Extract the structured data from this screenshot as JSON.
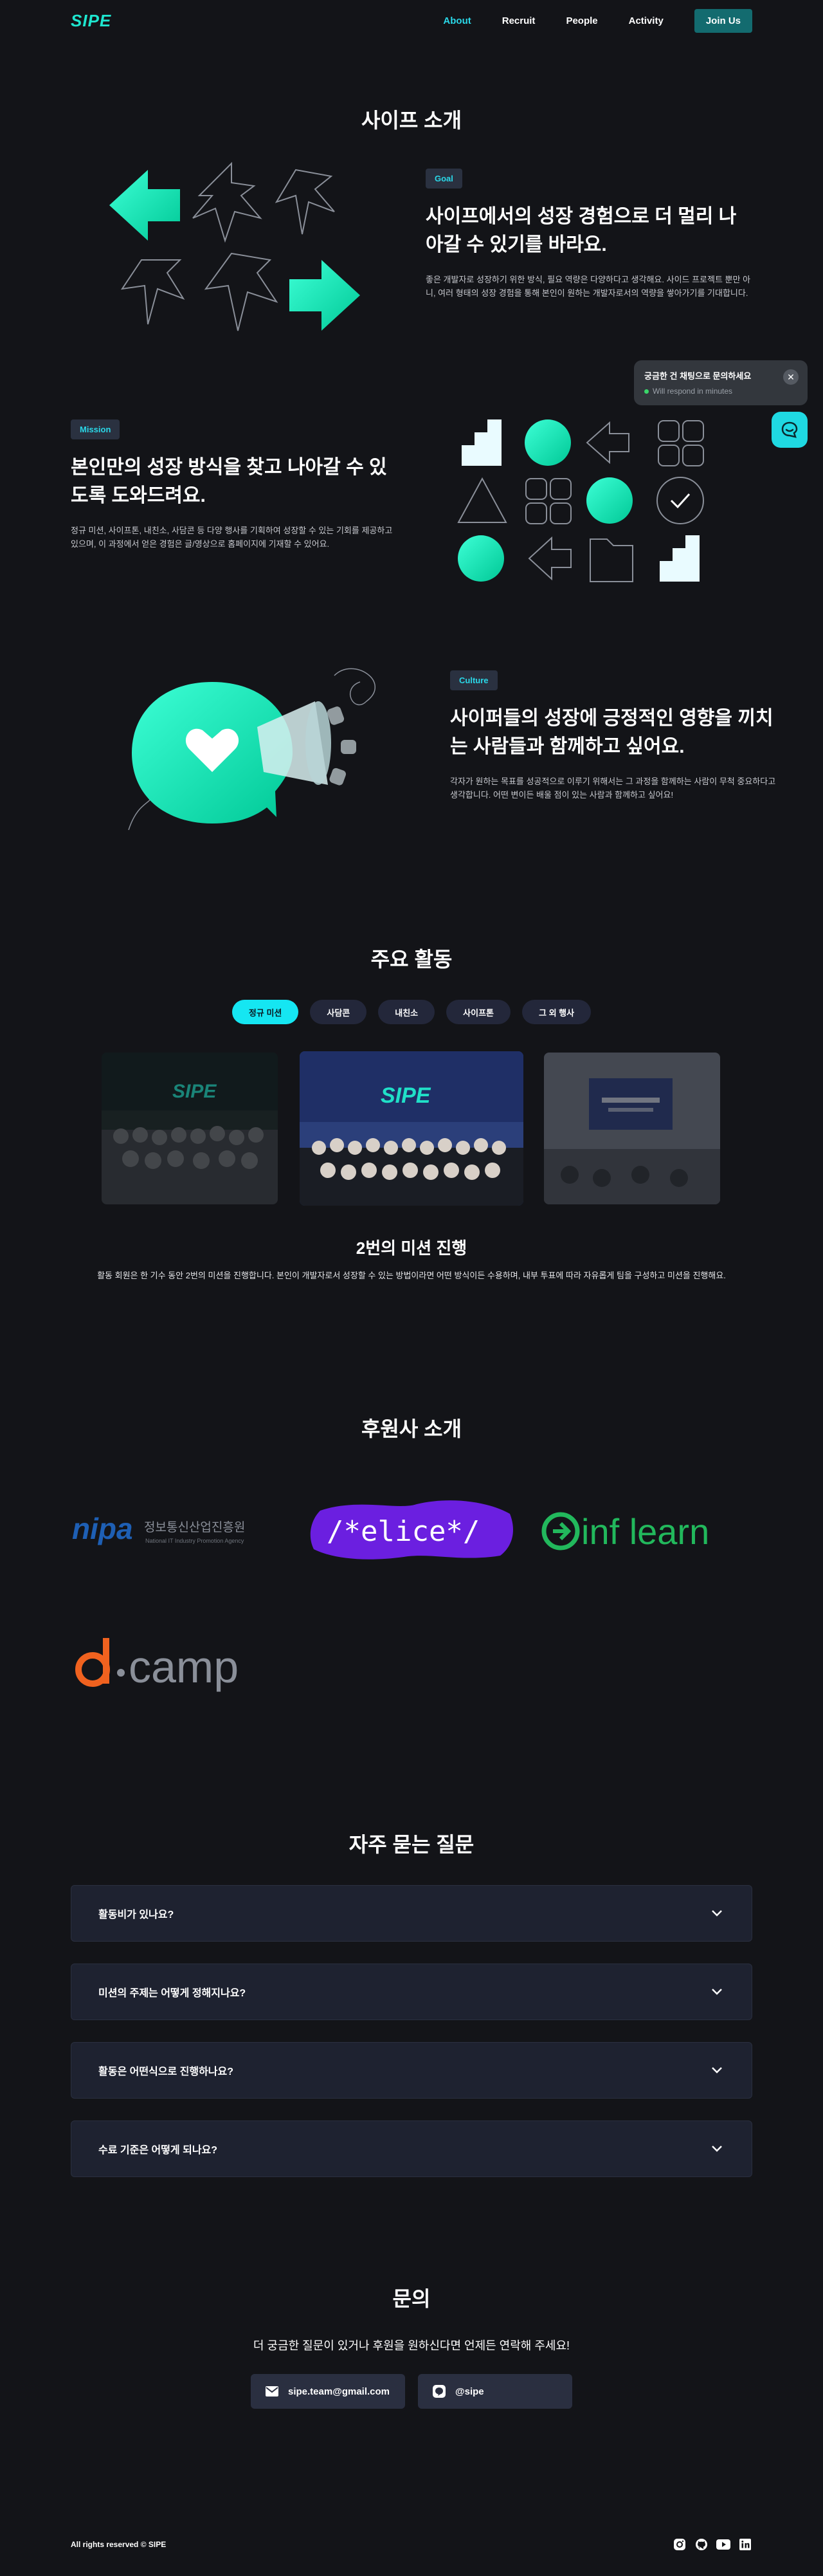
{
  "nav": {
    "logo": "SIPE",
    "links": [
      "About",
      "Recruit",
      "People",
      "Activity"
    ],
    "active": "About",
    "join_label": "Join Us"
  },
  "intro": {
    "title": "사이프 소개",
    "blocks": [
      {
        "tag": "Goal",
        "heading": "사이프에서의 성장 경험으로 더 멀리 나아갈 수 있기를 바라요.",
        "desc": "좋은 개발자로 성장하기 위한 방식, 필요 역량은 다양하다고 생각해요. 사이드 프로젝트 뿐만 아니, 여러 형태의 성장 경험을 통해 본인이 원하는 개발자로서의 역량을 쌓아가기를 기대합니다."
      },
      {
        "tag": "Mission",
        "heading": "본인만의 성장 방식을 찾고 나아갈 수 있도록 도와드려요.",
        "desc": "정규 미션, 사이프톤, 내친소, 사담콘 등 다양 행사를 기획하여 성장할 수 있는 기회를 제공하고 있으며, 이 과정에서 얻은 경험은 글/영상으로 홈페이지에 기재할 수 있어요."
      },
      {
        "tag": "Culture",
        "heading": "사이퍼들의 성장에 긍정적인 영향을 끼치는 사람들과 함께하고 싶어요.",
        "desc": "각자가 원하는 목표를 성공적으로 이루기 위해서는 그 과정을 함께하는 사람이 무척 중요하다고 생각합니다. 어떤 변이든 배울 점이 있는 사람과 함께하고 싶어요!"
      }
    ]
  },
  "chat": {
    "title": "궁금한 건 채팅으로 문의하세요",
    "status": "Will respond in minutes"
  },
  "activities": {
    "title": "주요 활동",
    "tabs": [
      "정규 미션",
      "사담콘",
      "내친소",
      "사이프톤",
      "그 외 행사"
    ],
    "active_tab": "정규 미션",
    "banner_text": "SIPE",
    "slide_title": "2번의 미션 진행",
    "slide_desc": "활동 회원은 한 기수 동안 2번의 미션을 진행합니다. 본인이 개발자로서 성장할 수 있는 방법이라면 어떤 방식이든 수용하며, 내부 투표에 따라 자유롭게 팀을 구성하고 미션을 진행해요."
  },
  "sponsors": {
    "title": "후원사 소개",
    "nipa_mark": "nipa",
    "nipa_ko": "정보통신산업진흥원",
    "nipa_en": "National IT Industry Promotion Agency",
    "elice": "/*elice*/",
    "inflearn": "inf learn",
    "dcamp": "camp"
  },
  "faq": {
    "title": "자주 묻는 질문",
    "items": [
      "활동비가 있나요?",
      "미션의 주제는 어떻게 정해지나요?",
      "활동은 어떤식으로 진행하나요?",
      "수료 기준은 어떻게 되나요?"
    ]
  },
  "contact": {
    "title": "문의",
    "subtitle": "더 궁금한 질문이 있거나 후원을 원하신다면 언제든 연락해 주세요!",
    "email": "sipe.team@gmail.com",
    "kakao": "@sipe"
  },
  "footer": {
    "copyright": "All rights reserved © SIPE",
    "socials": [
      "instagram-icon",
      "github-icon",
      "youtube-icon",
      "linkedin-icon"
    ]
  },
  "colors": {
    "accent": "#15e6f2",
    "mint": "#1ee6cf",
    "background": "#131418"
  }
}
